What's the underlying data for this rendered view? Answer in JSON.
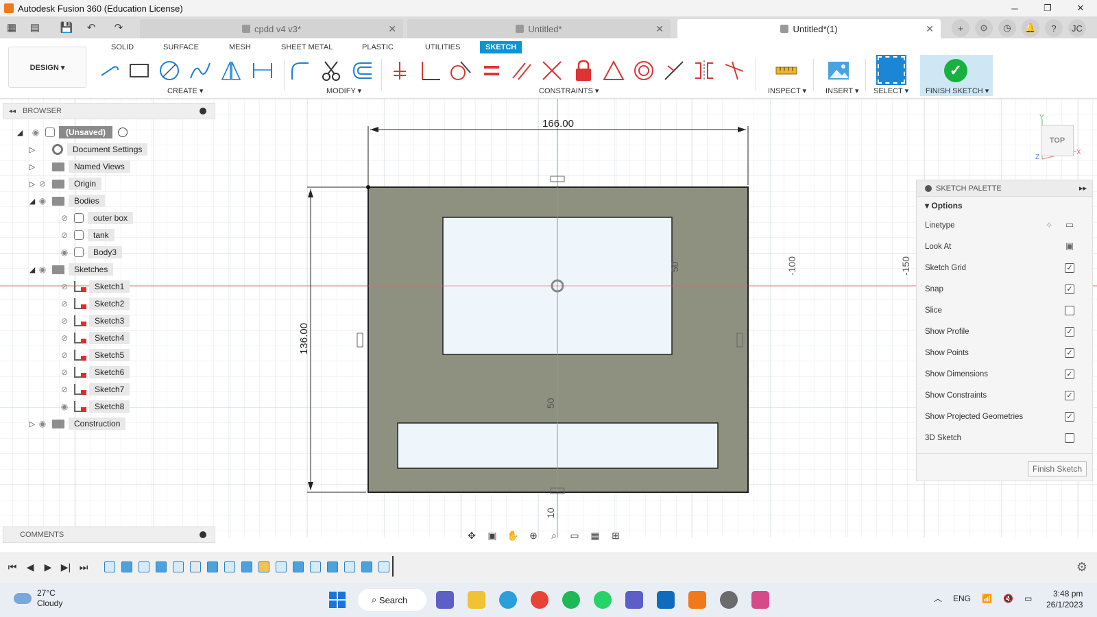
{
  "window": {
    "title": "Autodesk Fusion 360 (Education License)",
    "minimize": "─",
    "maximize": "❐",
    "close": "✕"
  },
  "doc_tabs": [
    {
      "label": "cpdd v4 v3*",
      "active": false
    },
    {
      "label": "Untitled*",
      "active": false
    },
    {
      "label": "Untitled*(1)",
      "active": true
    }
  ],
  "user_initials": "JC",
  "workspace": {
    "design_label": "DESIGN ▾",
    "tabs": [
      "SOLID",
      "SURFACE",
      "MESH",
      "SHEET METAL",
      "PLASTIC",
      "UTILITIES",
      "SKETCH"
    ],
    "active_tab": "SKETCH",
    "group_labels": {
      "create": "CREATE ▾",
      "modify": "MODIFY ▾",
      "constraints": "CONSTRAINTS ▾",
      "inspect": "INSPECT ▾",
      "insert": "INSERT ▾",
      "select": "SELECT ▾",
      "finish": "FINISH SKETCH ▾"
    }
  },
  "browser": {
    "title": "BROWSER",
    "root": "(Unsaved)",
    "items": [
      {
        "label": "Document Settings",
        "icon": "gear-icon"
      },
      {
        "label": "Named Views",
        "icon": "folder-icon"
      },
      {
        "label": "Origin",
        "icon": "folder-icon"
      },
      {
        "label": "Bodies",
        "icon": "folder-icon"
      },
      {
        "label": "outer box",
        "icon": "body-icon"
      },
      {
        "label": "tank",
        "icon": "body-icon"
      },
      {
        "label": "Body3",
        "icon": "body-icon"
      },
      {
        "label": "Sketches",
        "icon": "folder-icon"
      },
      {
        "label": "Sketch1",
        "icon": "sketch-icon"
      },
      {
        "label": "Sketch2",
        "icon": "sketch-icon"
      },
      {
        "label": "Sketch3",
        "icon": "sketch-icon"
      },
      {
        "label": "Sketch4",
        "icon": "sketch-icon"
      },
      {
        "label": "Sketch5",
        "icon": "sketch-icon"
      },
      {
        "label": "Sketch6",
        "icon": "sketch-icon"
      },
      {
        "label": "Sketch7",
        "icon": "sketch-icon"
      },
      {
        "label": "Sketch8",
        "icon": "sketch-icon"
      },
      {
        "label": "Construction",
        "icon": "folder-icon"
      }
    ]
  },
  "comments_label": "COMMENTS",
  "sketch": {
    "dim_width": "166.00",
    "dim_height": "136.00",
    "dim_50_a": "50",
    "dim_50_b": "50",
    "dim_100": "-100",
    "dim_150": "-150",
    "dim_10": "10"
  },
  "viewcube": {
    "face": "TOP",
    "axis_y": "Y",
    "axis_x": "X",
    "axis_z": "Z"
  },
  "palette": {
    "title": "SKETCH PALETTE",
    "section": "Options",
    "options": [
      {
        "label": "Linetype",
        "type": "icons"
      },
      {
        "label": "Look At",
        "type": "icon"
      },
      {
        "label": "Sketch Grid",
        "type": "check",
        "checked": true
      },
      {
        "label": "Snap",
        "type": "check",
        "checked": true
      },
      {
        "label": "Slice",
        "type": "check",
        "checked": false
      },
      {
        "label": "Show Profile",
        "type": "check",
        "checked": true
      },
      {
        "label": "Show Points",
        "type": "check",
        "checked": true
      },
      {
        "label": "Show Dimensions",
        "type": "check",
        "checked": true
      },
      {
        "label": "Show Constraints",
        "type": "check",
        "checked": true
      },
      {
        "label": "Show Projected Geometries",
        "type": "check",
        "checked": true
      },
      {
        "label": "3D Sketch",
        "type": "check",
        "checked": false
      }
    ],
    "finish_button": "Finish Sketch"
  },
  "taskbar": {
    "temp": "27°C",
    "weather": "Cloudy",
    "search": "Search",
    "lang": "ENG",
    "time": "3:48 pm",
    "date": "26/1/2023"
  },
  "colors": {
    "accent": "#0696d7",
    "sketch_profile": "#8e9180",
    "profile_fill": "#eef5fb",
    "finish_green": "#16b13e"
  }
}
